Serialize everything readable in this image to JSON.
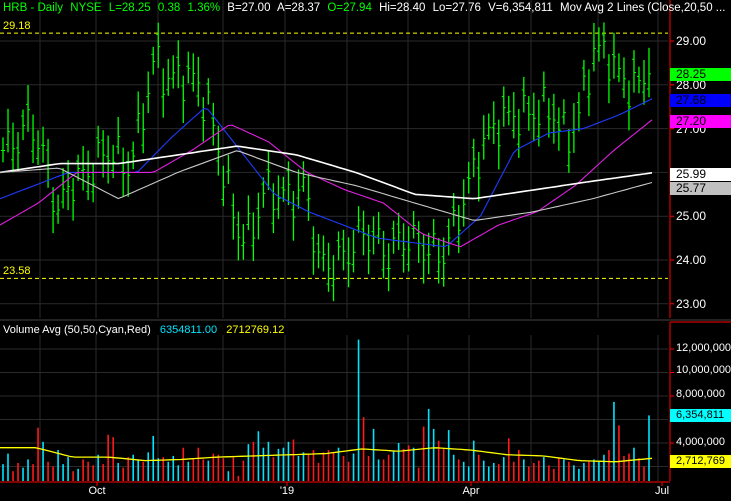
{
  "header": {
    "symbol": "HRB - Daily",
    "exchange": "NYSE",
    "last": "L=28.25",
    "change": "0.38",
    "change_pct": "1.36%",
    "bid": "B=27.00",
    "ask": "A=28.37",
    "open": "O=27.94",
    "high": "Hi=28.40",
    "low": "Lo=27.76",
    "volume": "V=6,354,811",
    "study": "Mov Avg 2 Lines (Close,20,50 ..."
  },
  "levels": {
    "high_label": "29.18",
    "high": 29.18,
    "low_label": "23.58",
    "low": 23.58
  },
  "price_axis": {
    "ticks": [
      "29.00",
      "28.00",
      "27.00",
      "25.00",
      "24.00",
      "23.00"
    ]
  },
  "badges": {
    "last": {
      "label": "28.25",
      "color": "#00ff00"
    },
    "ma20": {
      "label": "27.68",
      "color": "#0000ff"
    },
    "ma50": {
      "label": "27.20",
      "color": "#ff00ff"
    },
    "ma100": {
      "label": "25.99",
      "color": "#ffffff"
    },
    "ma200": {
      "label": "25.77",
      "color": "#c0c0c0"
    }
  },
  "volume_header": {
    "title": "Volume Avg (50,50,Cyan,Red)",
    "vol": "6354811.00",
    "avg": "2712769.12"
  },
  "volume_axis": {
    "ticks": [
      "12,000,000",
      "10,000,000",
      "8,000,000",
      "4,000,000"
    ]
  },
  "volume_badges": {
    "vol": {
      "label": "6,354,811",
      "color": "#00ffff"
    },
    "avg": {
      "label": "2,712,769",
      "color": "#ffff00"
    }
  },
  "date_axis": {
    "labels": [
      "Oct",
      "'19",
      "Apr",
      "Jul"
    ]
  },
  "chart_data": {
    "type": "ohlc",
    "title": "HRB - Daily NYSE",
    "price_range": [
      22.8,
      29.9
    ],
    "close_path": [
      26.5,
      26.7,
      27.2,
      26.3,
      25.1,
      25.8,
      25.9,
      26.3,
      26.5,
      26.0,
      27.0,
      28.6,
      28.1,
      28.2,
      28.1,
      27.4,
      26.1,
      24.7,
      24.5,
      25.6,
      25.5,
      25.4,
      25.7,
      23.9,
      23.9,
      24.1,
      24.6,
      24.5,
      24.1,
      24.5,
      24.4,
      24.2,
      24.1,
      24.9,
      25.8,
      26.7,
      27.1,
      27.3,
      27.3,
      27.4,
      27.4,
      26.7,
      27.4,
      28.8,
      28.7,
      28.1,
      27.9,
      28.25
    ],
    "ma_lines": [
      {
        "name": "MA20",
        "color": "#1e3cff",
        "values": [
          25.4,
          25.7,
          26.0,
          26.0,
          26.0,
          26.8,
          27.5,
          26.5,
          25.5,
          25.1,
          24.8,
          24.5,
          24.4,
          24.3,
          25.0,
          26.5,
          26.9,
          27.0,
          27.3,
          27.68
        ]
      },
      {
        "name": "MA50",
        "color": "#e020e0",
        "values": [
          24.8,
          25.3,
          26.0,
          26.0,
          26.0,
          26.5,
          27.1,
          26.7,
          26.0,
          25.6,
          25.3,
          24.6,
          24.3,
          24.8,
          25.1,
          25.7,
          26.5,
          27.2
        ]
      },
      {
        "name": "MA100",
        "color": "#ffffff",
        "values": [
          26.0,
          26.2,
          26.2,
          26.4,
          26.6,
          26.4,
          26.0,
          25.5,
          25.4,
          25.6,
          25.8,
          25.99
        ]
      },
      {
        "name": "MA200",
        "color": "#c8c8c8",
        "values": [
          26.0,
          26.1,
          25.4,
          26.0,
          26.5,
          26.0,
          25.7,
          25.3,
          24.9,
          25.1,
          25.4,
          25.77
        ]
      }
    ],
    "volume_millions": [
      2.2,
      3.1,
      1.6,
      2.3,
      1.9,
      2.6,
      2.2,
      5.3,
      4.1,
      2.4,
      2.0,
      3.4,
      2.2,
      2.8,
      1.6,
      1.8,
      2.6,
      2.4,
      2.1,
      3.0,
      2.2,
      4.7,
      4.5,
      2.3,
      1.9,
      2.8,
      3.0,
      2.6,
      2.4,
      3.2,
      4.6,
      2.7,
      2.8,
      2.4,
      2.9,
      2.1,
      3.6,
      2.4,
      2.7,
      3.6,
      2.6,
      2.5,
      3.1,
      3.0,
      2.7,
      1.6,
      2.9,
      1.2,
      2.5,
      3.9,
      4.1,
      5.0,
      3.6,
      4.1,
      2.8,
      3.5,
      3.6,
      4.1,
      4.3,
      2.9,
      3.2,
      3.1,
      3.4,
      2.3,
      3.2,
      3.4,
      3.2,
      3.6,
      2.9,
      2.4,
      3.1,
      12.8,
      6.2,
      2.9,
      5.2,
      2.6,
      2.6,
      3.0,
      3.3,
      4.0,
      3.5,
      3.8,
      3.6,
      1.9,
      5.4,
      6.9,
      5.2,
      4.2,
      3.5,
      5.1,
      3.0,
      2.6,
      2.4,
      2.0,
      4.2,
      3.0,
      2.5,
      2.0,
      2.3,
      2.2,
      2.8,
      4.4,
      2.4,
      3.4,
      2.6,
      2.0,
      2.3,
      2.5,
      2.8,
      2.1,
      1.8,
      2.7,
      2.6,
      2.4,
      2.1,
      1.8,
      2.3,
      2.5,
      2.6,
      2.4,
      3.0,
      3.4,
      7.5,
      5.5,
      2.9,
      3.1,
      3.6,
      2.7,
      2.0,
      6.35
    ],
    "volume_avg_millions": [
      3.6,
      3.6,
      2.8,
      2.8,
      2.5,
      2.6,
      2.8,
      2.9,
      3.0,
      3.1,
      3.5,
      3.3,
      3.6,
      3.4,
      3.0,
      2.9,
      2.5,
      2.4,
      2.7
    ],
    "volume_range_millions": [
      0,
      13
    ],
    "up_color": "#00e5ff",
    "down_color": "#ff1a1a",
    "bar_color": "#00ff00"
  }
}
